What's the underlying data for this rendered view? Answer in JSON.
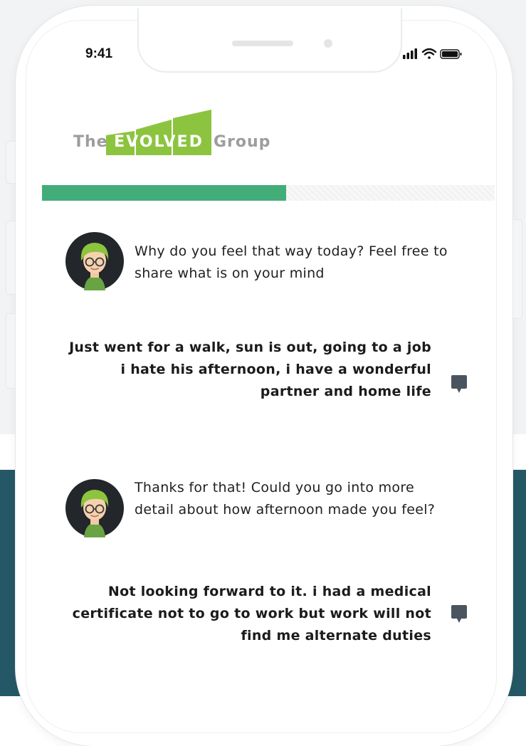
{
  "status_bar": {
    "time": "9:41"
  },
  "logo": {
    "the": "The",
    "evolved": "EVOLVED",
    "group": "Group"
  },
  "progress": {
    "fraction": 0.54
  },
  "messages": [
    {
      "sender": "bot",
      "text": "Why do you feel that way today?  Feel free to share what is on your mind"
    },
    {
      "sender": "user",
      "text": "Just went for a walk, sun is out, going to a job i hate his afternoon, i have a wonderful partner and home life"
    },
    {
      "sender": "bot",
      "text": "Thanks for that! Could you go into more detail about how afternoon made you feel?"
    },
    {
      "sender": "user",
      "text": "Not looking forward to it. i had a medical certificate not to go to work but work will not find me alternate duties"
    }
  ],
  "icons": {
    "signal": "cellular-signal-icon",
    "wifi": "wifi-icon",
    "battery": "battery-icon",
    "comment": "comment-icon",
    "avatar": "bot-avatar"
  },
  "colors": {
    "brand_green": "#8cc43f",
    "progress_green": "#42ad78",
    "teal_background": "#255866",
    "chat_icon": "#4b5560"
  }
}
